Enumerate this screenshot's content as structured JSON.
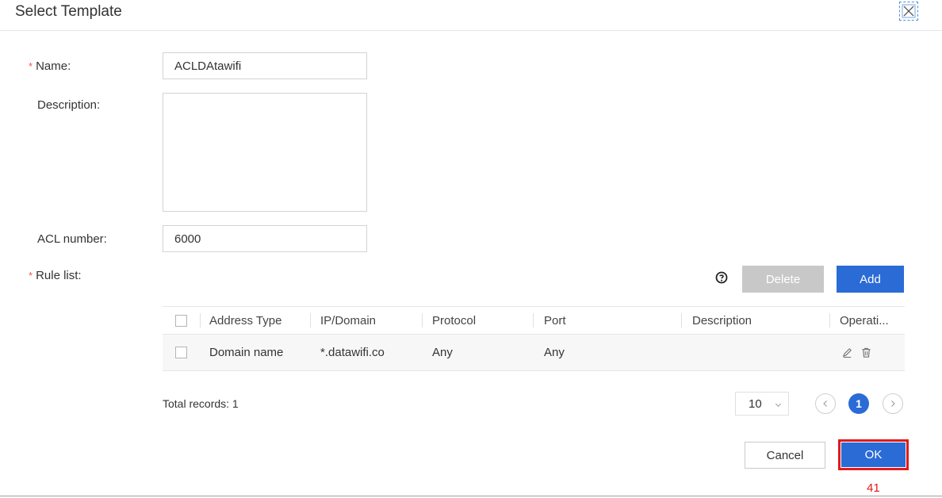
{
  "dialog": {
    "title": "Select Template"
  },
  "form": {
    "name_label": "Name:",
    "name_value": "ACLDAtawifi",
    "description_label": "Description:",
    "description_value": "",
    "acl_label": "ACL number:",
    "acl_value": "6000",
    "rule_list_label": "Rule list:",
    "required_mark": "*"
  },
  "toolbar": {
    "delete_label": "Delete",
    "add_label": "Add"
  },
  "table": {
    "headers": [
      "Address Type",
      "IP/Domain",
      "Protocol",
      "Port",
      "Description",
      "Operati..."
    ],
    "rows": [
      {
        "address_type": "Domain name",
        "ip_domain": "*.datawifi.co",
        "protocol": "Any",
        "port": "Any",
        "description": ""
      }
    ]
  },
  "pagination": {
    "total_records": "Total records: 1",
    "page_size": "10",
    "current_page": "1"
  },
  "footer": {
    "cancel_label": "Cancel",
    "ok_label": "OK",
    "step_number": "41"
  },
  "colors": {
    "primary": "#2a6bd6",
    "disabled": "#c8c8c8",
    "required": "#e85a5a",
    "highlight": "#e01b1b"
  },
  "icons": {
    "close": "close-icon",
    "help": "help-icon",
    "edit": "edit-icon",
    "delete": "trash-icon",
    "prev": "chevron-left-icon",
    "next": "chevron-right-icon",
    "caret": "chevron-down-icon"
  }
}
